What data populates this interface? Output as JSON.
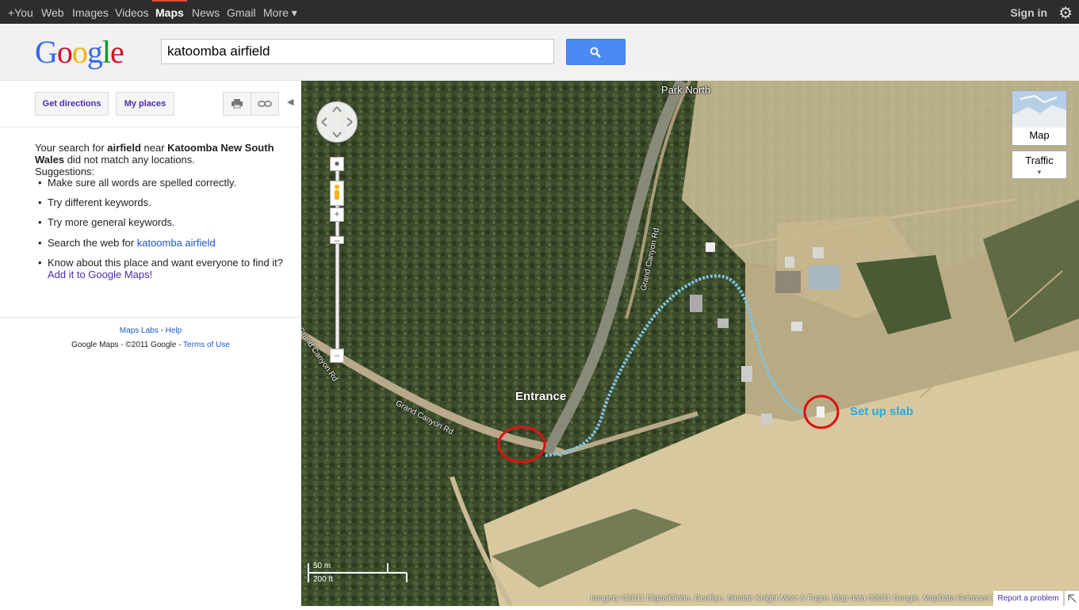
{
  "topbar": {
    "links": [
      "+You",
      "Web",
      "Images",
      "Videos",
      "Maps",
      "News",
      "Gmail",
      "More ▾"
    ],
    "active": "Maps",
    "sign_in": "Sign in",
    "gear_icon": "gear-icon",
    "active_color": "#dd4b39"
  },
  "header": {
    "logo": [
      "G",
      "o",
      "o",
      "g",
      "l",
      "e"
    ],
    "search_value": "katoomba airfield",
    "search_icon": "search-icon"
  },
  "panel": {
    "get_directions": "Get directions",
    "my_places": "My places",
    "print_icon": "print-icon",
    "link_icon": "link-icon",
    "collapse_icon": "collapse-arrow-icon",
    "msg_pre": "Your search for ",
    "msg_term": "airfield",
    "msg_mid": " near ",
    "msg_place": "Katoomba New South Wales",
    "msg_post": " did not match any locations.",
    "suggestions_label": "Suggestions:",
    "suggestions": [
      "Make sure all words are spelled correctly.",
      "Try different keywords.",
      "Try more general keywords."
    ],
    "search_web_pre": "Search the web for ",
    "search_web_link": "katoomba airfield",
    "know_place": "Know about this place and want everyone to find it?",
    "add_link": "Add it to Google Maps!",
    "maps_labs": "Maps Labs",
    "help": "Help",
    "copyright": "Google Maps - ©2011 Google - ",
    "terms": "Terms of Use"
  },
  "map": {
    "label_park_north": "Park North",
    "label_road1": "Grand Canyon Rd",
    "label_road2": "Grand Canyon Rd",
    "label_road3": "Grand Canyon Rd",
    "annotation_entrance": "Entrance",
    "annotation_slab": "Set up slab",
    "map_type": "Map",
    "traffic": "Traffic",
    "scale_m": "50 m",
    "scale_ft": "200 ft",
    "imagery_credit": "Imagery ©2011 DigitalGlobe, GeoEye, Sinclair Knight Merz & Fugro, Map data ©2011 Google, MapData Sciences Pty Ltd, PSMA",
    "report": "Report a problem",
    "annotation_color": "#29a9e0",
    "circle_color": "#e01010"
  }
}
